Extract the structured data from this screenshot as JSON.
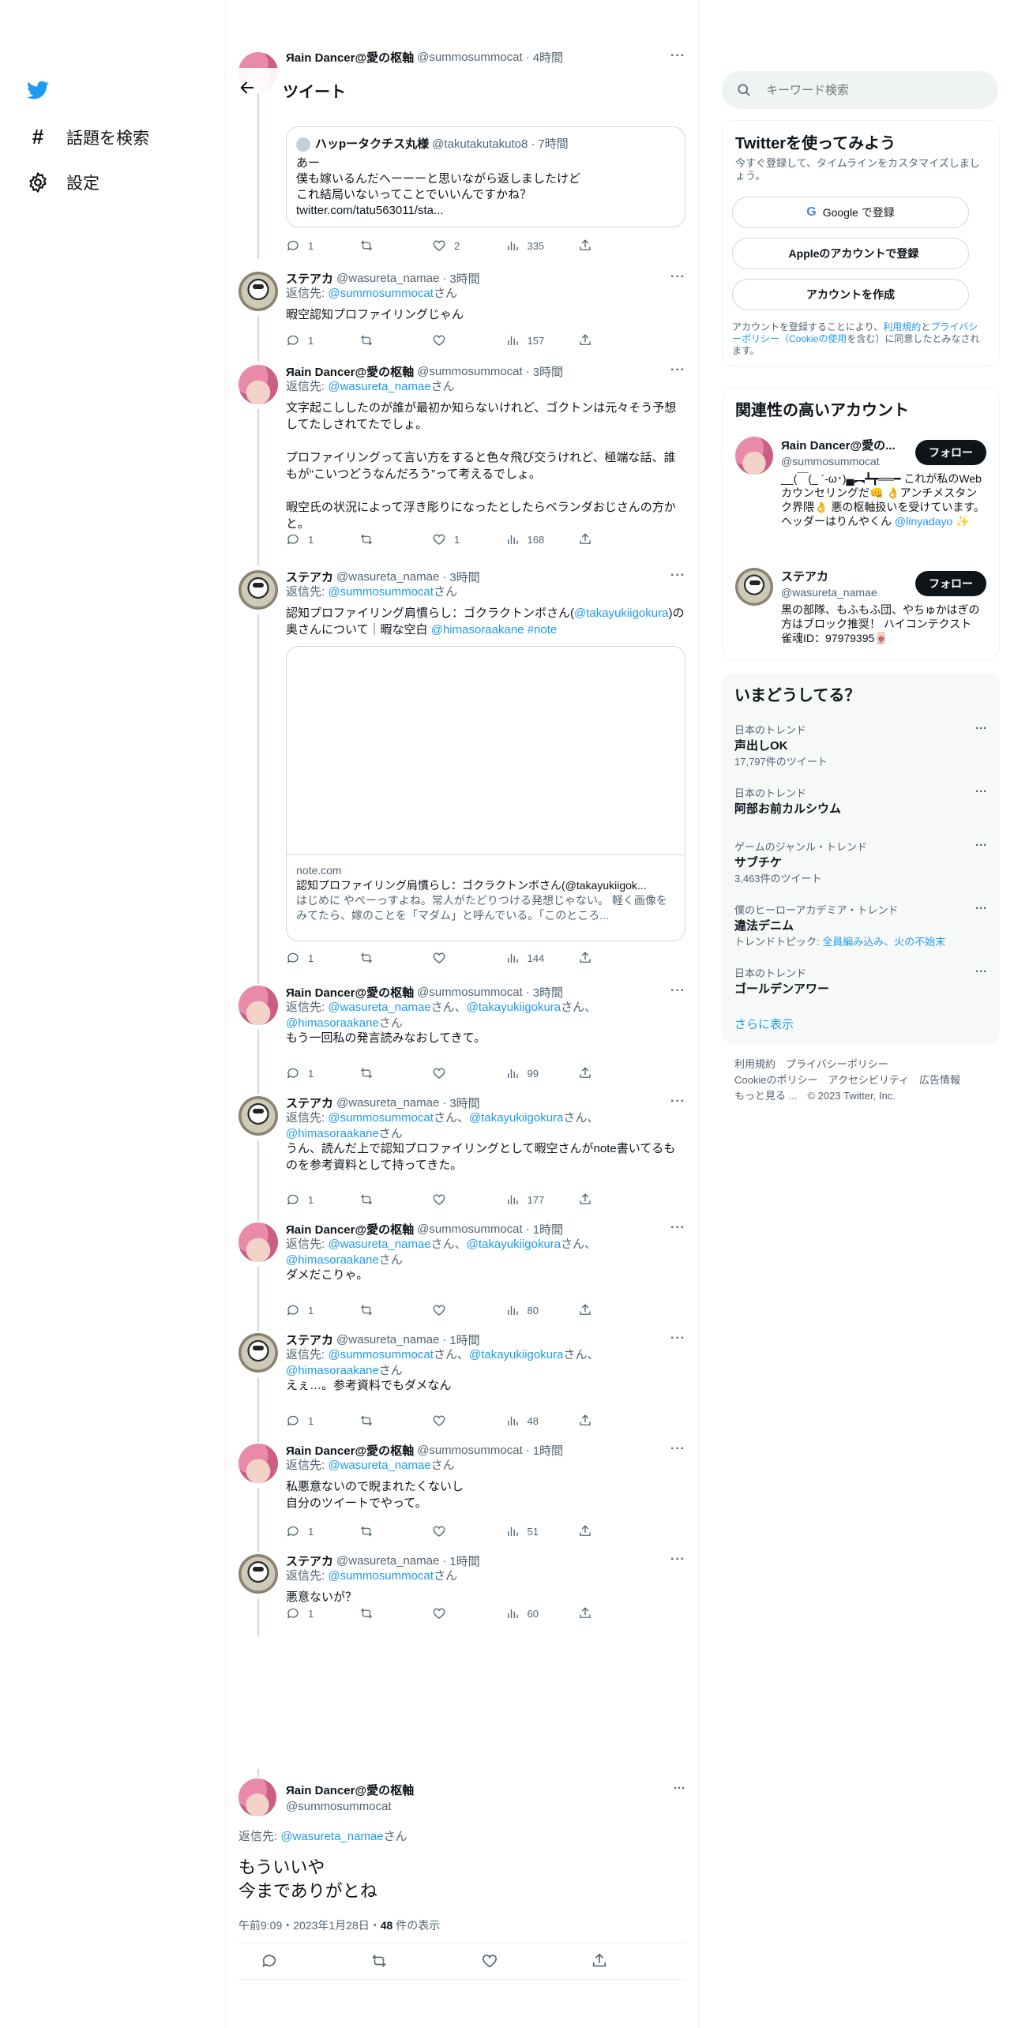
{
  "nav": {
    "explore_label": "話題を検索",
    "settings_label": "設定"
  },
  "header": {
    "title": "ツイート"
  },
  "top_tweet": {
    "name": "Яain Dancer@愛の枢軸",
    "handle": "@summosummocat",
    "time": "4時間",
    "quote": {
      "name": "ハッpータクチス丸様",
      "handle": "@takutakutakuto8",
      "time": "7時間",
      "text": "あー\n僕も嫁いるんだへーーーと思いながら返しましたけど\nこれ結局いないってことでいいんですかね？\ntwitter.com/tatu563011/sta..."
    },
    "stats": {
      "replies": "1",
      "retweets": "",
      "likes": "2",
      "views": "335"
    }
  },
  "tweets": [
    {
      "name": "ステアカ",
      "handle": "@wasureta_namae",
      "time": "3時間",
      "reply_to": "@summosummocat",
      "reply_suffix": "さん",
      "text": "暇空認知プロファイリングじゃん",
      "stats": {
        "replies": "1",
        "likes": "",
        "views": "157"
      }
    },
    {
      "name": "Яain Dancer@愛の枢軸",
      "handle": "@summosummocat",
      "time": "3時間",
      "reply_to": "@wasureta_namae",
      "reply_suffix": "さん",
      "text": "文字起こししたのが誰が最初か知らないけれど、ゴクトンは元々そう予想してたしされてたでしょ。\n\nプロファイリングって言い方をすると色々飛び交うけれど、極端な話、誰もが“こいつどうなんだろう”って考えるでしょ。\n\n暇空氏の状況によって浮き彫りになったとしたらベランダおじさんの方かと。",
      "stats": {
        "replies": "1",
        "likes": "1",
        "views": "168"
      }
    },
    {
      "name": "ステアカ",
      "handle": "@wasureta_namae",
      "time": "3時間",
      "reply_to": "@summosummocat",
      "reply_suffix": "さん",
      "text_a": "認知プロファイリング肩慣らし：ゴクラクトンボさん(",
      "mention": "@takayukiigokura",
      "text_b": ")の奥さんについて｜暇な空白 ",
      "mention2": "@himasoraakane",
      "hashtag": "#note",
      "card": {
        "domain": "note.com",
        "title": "認知プロファイリング肩慣らし：ゴクラクトンボさん(@takayukiigok...",
        "desc": "はじめに やぺーっすよね。常人がたどりつける発想じゃない。 軽く画像をみてたら、嫁のことを「マダム」と呼んでいる。「このところ..."
      },
      "stats": {
        "replies": "1",
        "likes": "",
        "views": "144"
      }
    },
    {
      "name": "Яain Dancer@愛の枢軸",
      "handle": "@summosummocat",
      "time": "3時間",
      "reply_to_list": [
        "@wasureta_namae",
        "@takayukiigokura",
        "@himasoraakane"
      ],
      "text": "もう一回私の発言読みなおしてきて。",
      "stats": {
        "replies": "1",
        "likes": "",
        "views": "99"
      }
    },
    {
      "name": "ステアカ",
      "handle": "@wasureta_namae",
      "time": "3時間",
      "reply_to_list": [
        "@summosummocat",
        "@takayukiigokura",
        "@himasoraakane"
      ],
      "text": "うん、読んだ上で認知プロファイリングとして暇空さんがnote書いてるものを参考資料として持ってきた。",
      "stats": {
        "replies": "1",
        "likes": "",
        "views": "177"
      }
    },
    {
      "name": "Яain Dancer@愛の枢軸",
      "handle": "@summosummocat",
      "time": "1時間",
      "reply_to_list": [
        "@wasureta_namae",
        "@takayukiigokura",
        "@himasoraakane"
      ],
      "text": "ダメだこりゃ。",
      "stats": {
        "replies": "1",
        "likes": "",
        "views": "80"
      }
    },
    {
      "name": "ステアカ",
      "handle": "@wasureta_namae",
      "time": "1時間",
      "reply_to_list": [
        "@summosummocat",
        "@takayukiigokura",
        "@himasoraakane"
      ],
      "text": "えぇ…。参考資料でもダメなん",
      "stats": {
        "replies": "1",
        "likes": "",
        "views": "48"
      }
    },
    {
      "name": "Яain Dancer@愛の枢軸",
      "handle": "@summosummocat",
      "time": "1時間",
      "reply_to": "@wasureta_namae",
      "reply_suffix": "さん",
      "text": "私悪意ないので睨まれたくないし\n自分のツイートでやって。",
      "stats": {
        "replies": "1",
        "likes": "",
        "views": "51"
      }
    },
    {
      "name": "ステアカ",
      "handle": "@wasureta_namae",
      "time": "1時間",
      "reply_to": "@summosummocat",
      "reply_suffix": "さん",
      "text": "悪意ないが？",
      "stats": {
        "replies": "1",
        "likes": "",
        "views": "60"
      }
    }
  ],
  "reply_separator": "さん、",
  "reply_end": "さん",
  "reply_prefix": "返信先: ",
  "main_tweet": {
    "name": "Яain Dancer@愛の枢軸",
    "handle": "@summosummocat",
    "reply_to": "@wasureta_namae",
    "reply_suffix": "さん",
    "text": "もういいや\n今までありがとね",
    "meta_time": "午前9:09・2023年1月28日・",
    "views_count": "48",
    "views_label": " 件の表示"
  },
  "search": {
    "placeholder": "キーワード検索"
  },
  "signup": {
    "title": "Twitterを使ってみよう",
    "subtitle": "今すぐ登録して、タイムラインをカスタマイズしましょう。",
    "google": "Google で登録",
    "apple": "Appleのアカウントで登録",
    "create": "アカウントを作成",
    "legal_a": "アカウントを登録することにより、",
    "terms": "利用規約",
    "legal_b": "と",
    "privacy": "プライバシーポリシー（Cookieの使用",
    "legal_c": "を含む）に同意したとみなされます。"
  },
  "who_to_follow": {
    "title": "関連性の高いアカウント",
    "follow": "フォロー",
    "accounts": [
      {
        "name": "Яain Dancer@愛の...",
        "handle": "@summosummocat",
        "bio_a": "__(￣(_ ´-ω･)▄︻┻┳══━ これが私のWebカウンセリングだ👊 👌アンチメスタンク界隈👌 悪の枢軸扱いを受けています。ヘッダーはりんやくん ",
        "bio_link": "@linyadayo",
        "bio_b": " ✨"
      },
      {
        "name": "ステアカ",
        "handle": "@wasureta_namae",
        "bio_a": "黒の部隊、もふもふ団、やちゅかはぎの方はブロック推奨！ ハイコンテクスト　雀魂ID：97979395🀄",
        "bio_link": "",
        "bio_b": ""
      }
    ]
  },
  "trends": {
    "title": "いまどうしてる？",
    "items": [
      {
        "context": "日本のトレンド",
        "name": "声出しOK",
        "count": "17,797件のツイート"
      },
      {
        "context": "日本のトレンド",
        "name": "阿部お前カルシウム",
        "count": ""
      },
      {
        "context": "ゲームのジャンル・トレンド",
        "name": "サブチケ",
        "count": "3,463件のツイート"
      },
      {
        "context": "僕のヒーローアカデミア・トレンド",
        "name": "違法デニム",
        "count": "",
        "topic_label": "トレンドトピック: ",
        "topic_links": "全員編み込み、火の不始末"
      },
      {
        "context": "日本のトレンド",
        "name": "ゴールデンアワー",
        "count": ""
      }
    ],
    "show_more": "さらに表示"
  },
  "footer": {
    "line1": "利用規約　プライバシーポリシー",
    "line2": "Cookieのポリシー　アクセシビリティ　広告情報",
    "line3": "もっと見る ...　© 2023 Twitter, Inc."
  },
  "colors": {
    "accent": "#1d9bf0",
    "text": "#0f1419",
    "muted": "#536471",
    "border": "#eff3f4"
  }
}
